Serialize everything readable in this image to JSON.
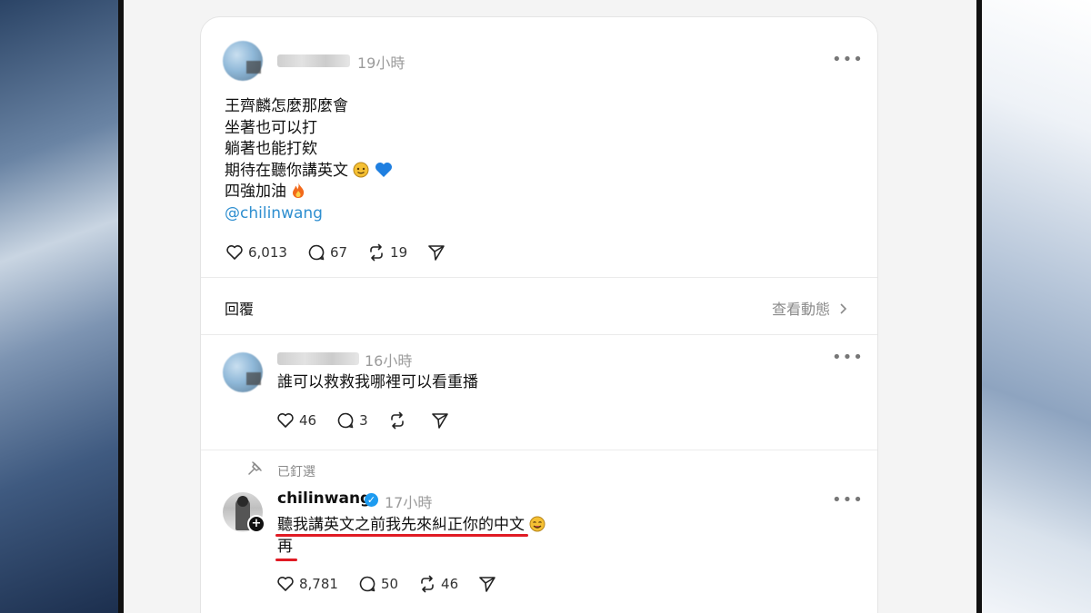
{
  "post": {
    "time": "19小時",
    "lines": [
      "王齊麟怎麼那麼會",
      "坐著也可以打",
      "躺著也能打欸",
      "期待在聽你講英文",
      "四強加油"
    ],
    "mention": "@chilinwang",
    "likes": "6,013",
    "comments": "67",
    "reposts": "19"
  },
  "replies_section": {
    "heading": "回覆",
    "view_activity": "查看動態"
  },
  "reply1": {
    "time": "16小時",
    "text": "誰可以救救我哪裡可以看重播",
    "likes": "46",
    "comments": "3"
  },
  "pinned_reply": {
    "pinned_label": "已釘選",
    "author": "chilinwang",
    "time": "17小時",
    "line1": "聽我講英文之前我先來糾正你的中文",
    "line2": "再",
    "likes": "8,781",
    "comments": "50",
    "reposts": "46"
  },
  "colors": {
    "mention": "#2f8fd0",
    "underline": "#e01b24",
    "verified": "#1d9bf0"
  },
  "icons": [
    "heart-icon",
    "comment-icon",
    "repost-icon",
    "share-icon",
    "more-icon",
    "pin-icon",
    "chevron-right-icon",
    "verified-icon",
    "plus-icon",
    "smile-emoji",
    "blue-heart-emoji",
    "fire-emoji"
  ]
}
